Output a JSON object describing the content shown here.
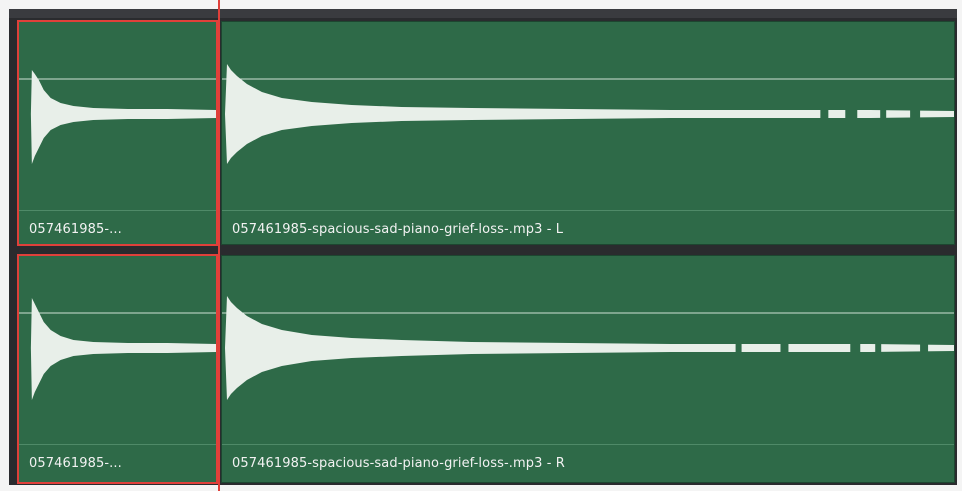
{
  "tracks": [
    {
      "channel": "L",
      "clips": [
        {
          "label": "057461985-...",
          "selected": true
        },
        {
          "label": "057461985-spacious-sad-piano-grief-loss-.mp3 - L",
          "selected": false
        }
      ]
    },
    {
      "channel": "R",
      "clips": [
        {
          "label": "057461985-...",
          "selected": true
        },
        {
          "label": "057461985-spacious-sad-piano-grief-loss-.mp3 - R",
          "selected": false
        }
      ]
    }
  ],
  "colors": {
    "clip": "#2e6a48",
    "waveform": "#e8efe9",
    "selection": "#e0403a",
    "background": "#2a2b2e"
  }
}
